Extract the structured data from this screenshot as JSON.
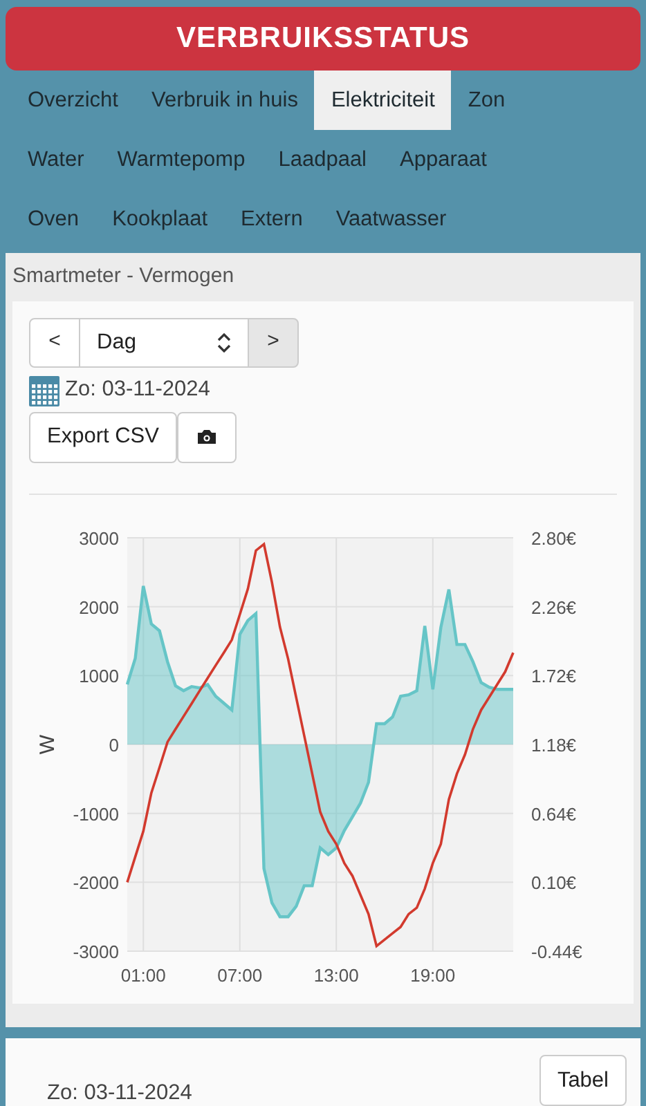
{
  "header": {
    "title": "VERBRUIKSSTATUS"
  },
  "tab_rows": [
    [
      {
        "label": "Overzicht",
        "selected": false
      },
      {
        "label": "Verbruik in huis",
        "selected": false
      },
      {
        "label": "Elektriciteit",
        "selected": true
      },
      {
        "label": "Zon",
        "selected": false
      }
    ],
    [
      {
        "label": "Water",
        "selected": false
      },
      {
        "label": "Warmtepomp",
        "selected": false
      },
      {
        "label": "Laadpaal",
        "selected": false
      },
      {
        "label": "Apparaat",
        "selected": false
      }
    ],
    [
      {
        "label": "Oven",
        "selected": false
      },
      {
        "label": "Kookplaat",
        "selected": false
      },
      {
        "label": "Extern",
        "selected": false
      },
      {
        "label": "Vaatwasser",
        "selected": false
      }
    ]
  ],
  "panel": {
    "title": "Smartmeter - Vermogen",
    "prev": "<",
    "period": "Dag",
    "next": ">",
    "date": "Zo: 03-11-2024",
    "export_button": "Export CSV",
    "chart_data": {
      "type": "area",
      "ylabel": "W",
      "grid": true,
      "x": [
        0,
        0.5,
        1,
        1.5,
        2,
        2.5,
        3,
        3.5,
        4,
        4.5,
        5,
        5.5,
        6,
        6.5,
        7,
        7.5,
        8,
        8.5,
        9,
        9.5,
        10,
        10.5,
        11,
        11.5,
        12,
        12.5,
        13,
        13.5,
        14,
        14.5,
        15,
        15.5,
        16,
        16.5,
        17,
        17.5,
        18,
        18.5,
        19,
        19.5,
        20,
        20.5,
        21,
        21.5,
        22,
        22.5,
        23,
        23.5,
        24
      ],
      "xlim": [
        0,
        24
      ],
      "xticks": [
        {
          "value": 1,
          "label": "01:00"
        },
        {
          "value": 7,
          "label": "07:00"
        },
        {
          "value": 13,
          "label": "13:00"
        },
        {
          "value": 19,
          "label": "19:00"
        }
      ],
      "ylim": [
        -3000,
        3000
      ],
      "yticks": [
        3000,
        2000,
        1000,
        0,
        -1000,
        -2000,
        -3000
      ],
      "y2lim": [
        -0.44,
        2.8
      ],
      "y2ticks": [
        {
          "value": 2.8,
          "label": "2.80€"
        },
        {
          "value": 2.26,
          "label": "2.26€"
        },
        {
          "value": 1.72,
          "label": "1.72€"
        },
        {
          "value": 1.18,
          "label": "1.18€"
        },
        {
          "value": 0.64,
          "label": "0.64€"
        },
        {
          "value": 0.1,
          "label": "0.10€"
        },
        {
          "value": -0.44,
          "label": "-0.44€"
        }
      ],
      "series": [
        {
          "color": "#66c5c7",
          "values": [
            870,
            1250,
            2300,
            1750,
            1650,
            1200,
            850,
            780,
            840,
            820,
            870,
            700,
            600,
            500,
            1600,
            1800,
            1900,
            -1800,
            -2300,
            -2500,
            -2500,
            -2350,
            -2050,
            -2050,
            -1500,
            -1600,
            -1500,
            -1250,
            -1050,
            -850,
            -550,
            300,
            300,
            400,
            700,
            720,
            780,
            1720,
            800,
            1700,
            2250,
            1450,
            1450,
            1200,
            900,
            830,
            800,
            800,
            800
          ]
        },
        {
          "type": "line",
          "axis": "y2",
          "color": "#d23a2e",
          "values": [
            0.1,
            0.3,
            0.5,
            0.8,
            1.0,
            1.2,
            1.3,
            1.4,
            1.5,
            1.6,
            1.7,
            1.8,
            1.9,
            2.0,
            2.2,
            2.4,
            2.7,
            2.75,
            2.45,
            2.1,
            1.85,
            1.55,
            1.25,
            0.95,
            0.65,
            0.5,
            0.4,
            0.25,
            0.15,
            0.0,
            -0.15,
            -0.4,
            -0.35,
            -0.3,
            -0.25,
            -0.15,
            -0.1,
            0.05,
            0.25,
            0.4,
            0.75,
            0.95,
            1.1,
            1.3,
            1.45,
            1.55,
            1.65,
            1.75,
            1.9
          ]
        }
      ]
    }
  },
  "summary": {
    "date": "Zo: 03-11-2024",
    "table_button": "Tabel"
  }
}
